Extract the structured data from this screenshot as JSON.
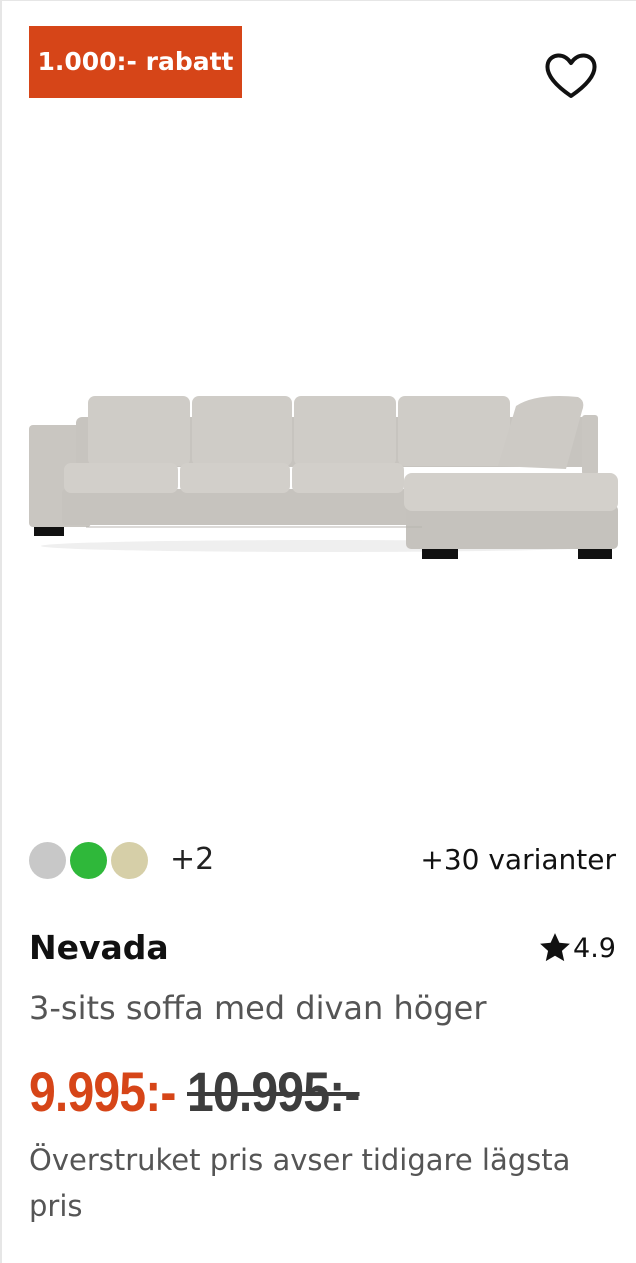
{
  "badge": {
    "label": "1.000:- rabatt"
  },
  "favorite": {
    "icon": "heart-outline-icon"
  },
  "image": {
    "alt": ""
  },
  "colors": {
    "swatches": [
      "#c8c8c8",
      "#2fb83a",
      "#d6cfa8"
    ],
    "more_label": "+2"
  },
  "variants_label": "+30 varianter",
  "product": {
    "name": "Nevada",
    "description": "3-sits soffa med divan höger",
    "rating": "4.9",
    "rating_icon": "star-icon"
  },
  "pricing": {
    "price": "9.995:-",
    "old_price": "10.995:-",
    "note": "Överstruket pris avser tidigare lägsta pris"
  },
  "theme": {
    "accent": "#d64518"
  }
}
